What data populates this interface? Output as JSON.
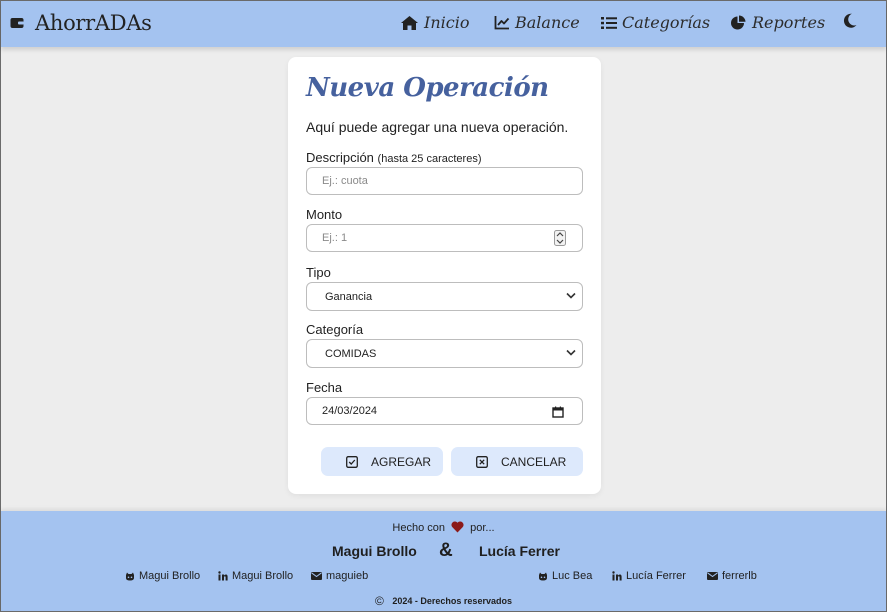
{
  "nav": {
    "brand": "AhorrADAs",
    "items": [
      {
        "label": "Inicio",
        "icon": "home-icon"
      },
      {
        "label": "Balance",
        "icon": "chart-line-icon"
      },
      {
        "label": "Categorías",
        "icon": "list-icon"
      },
      {
        "label": "Reportes",
        "icon": "pie-chart-icon"
      }
    ],
    "theme_icon": "moon-icon"
  },
  "form": {
    "title": "Nueva Operación",
    "subtitle": "Aquí puede agregar una nueva operación.",
    "descripcion": {
      "label": "Descripción",
      "hint": "(hasta 25 caracteres)",
      "placeholder": "Ej.: cuota",
      "value": ""
    },
    "monto": {
      "label": "Monto",
      "placeholder": "Ej.: 1",
      "value": ""
    },
    "tipo": {
      "label": "Tipo",
      "selected": "Ganancia"
    },
    "categoria": {
      "label": "Categoría",
      "selected": "COMIDAS"
    },
    "fecha": {
      "label": "Fecha",
      "value": "24/03/2024"
    },
    "add_label": "AGREGAR",
    "cancel_label": "CANCELAR"
  },
  "footer": {
    "made_before": "Hecho con",
    "made_after": "por...",
    "author1": "Magui Brollo",
    "amp": "&",
    "author2": "Lucía Ferrer",
    "links1": [
      {
        "label": "Magui Brollo",
        "icon": "github-icon"
      },
      {
        "label": "Magui Brollo",
        "icon": "linkedin-icon"
      },
      {
        "label": "maguieb",
        "icon": "email-icon"
      }
    ],
    "links2": [
      {
        "label": "Luc Bea",
        "icon": "github-icon"
      },
      {
        "label": "Lucía Ferrer",
        "icon": "linkedin-icon"
      },
      {
        "label": "ferrerlb",
        "icon": "email-icon"
      }
    ],
    "copyright_symbol": "©",
    "copyright": "2024 - Derechos reservados"
  },
  "colors": {
    "nav_bg": "#a4c3f0",
    "title": "#46619e",
    "button_bg": "#dde9fc",
    "heart": "#8b1a1a"
  }
}
